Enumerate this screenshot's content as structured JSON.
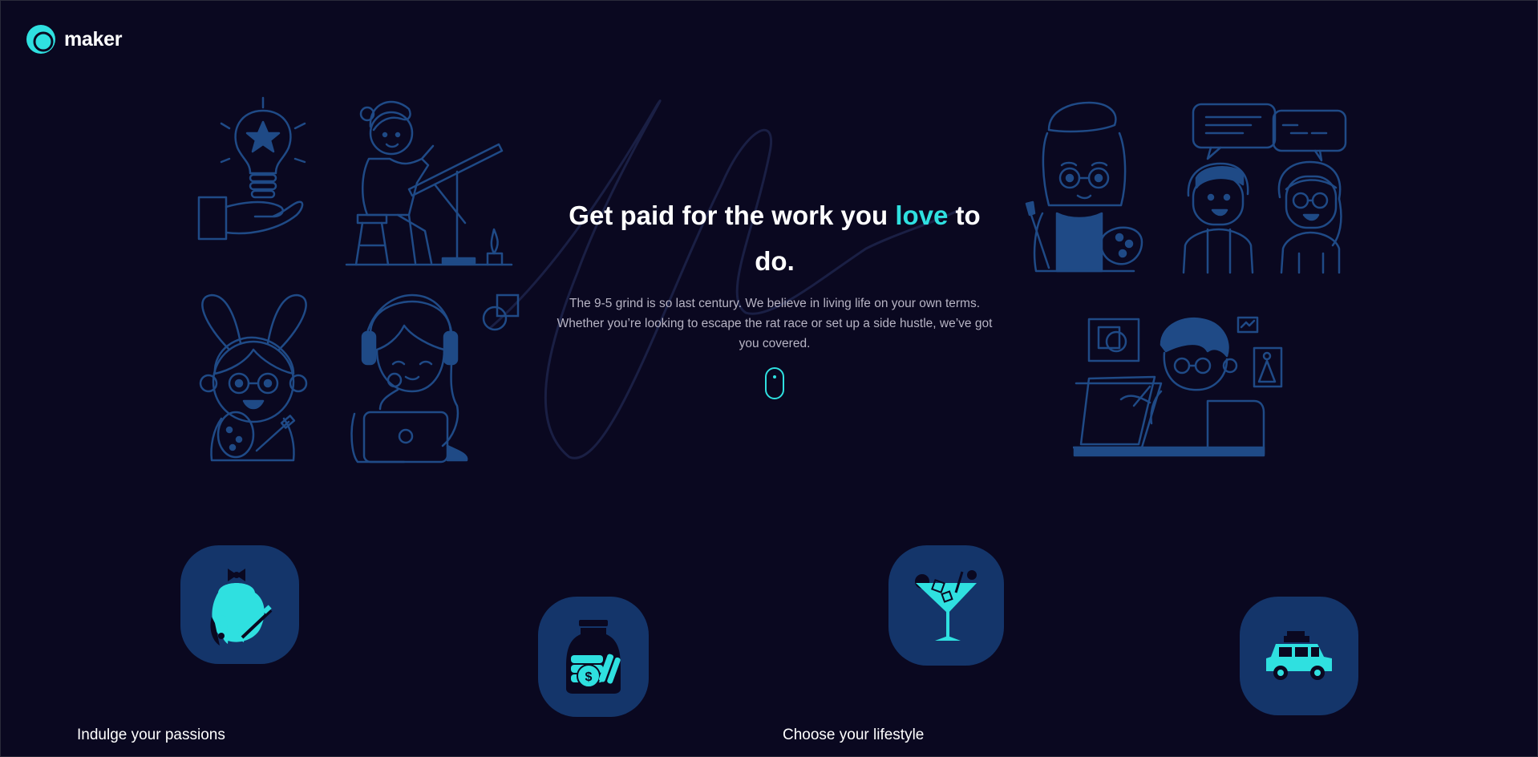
{
  "brand": {
    "name": "maker",
    "accent_color": "#2fe0e0",
    "background_color": "#0a0820",
    "line_color": "#1f4a86",
    "tile_color": "#14356a"
  },
  "hero": {
    "title_before": "Get paid for the work you ",
    "title_accent": "love",
    "title_after": " to do.",
    "subtitle": "The 9-5 grind is so last century. We believe in living life on your own terms. Whether you’re looking to escape the rat race or set up a side hustle, we’ve got you covered.",
    "scroll_icon": "mouse-icon"
  },
  "illustrations": [
    "lightbulb-hand-icon",
    "artist-drawing-desk-icon",
    "bunny-girl-icon",
    "headphones-laptop-person-icon",
    "painter-palette-icon",
    "chatting-couple-icon",
    "designer-tablet-icon"
  ],
  "features": [
    {
      "icon": "paint-palette-icon",
      "caption": "Indulge your passions"
    },
    {
      "icon": "money-jar-icon",
      "caption": ""
    },
    {
      "icon": "cocktail-icon",
      "caption": "Choose your lifestyle"
    },
    {
      "icon": "car-icon",
      "caption": ""
    }
  ]
}
